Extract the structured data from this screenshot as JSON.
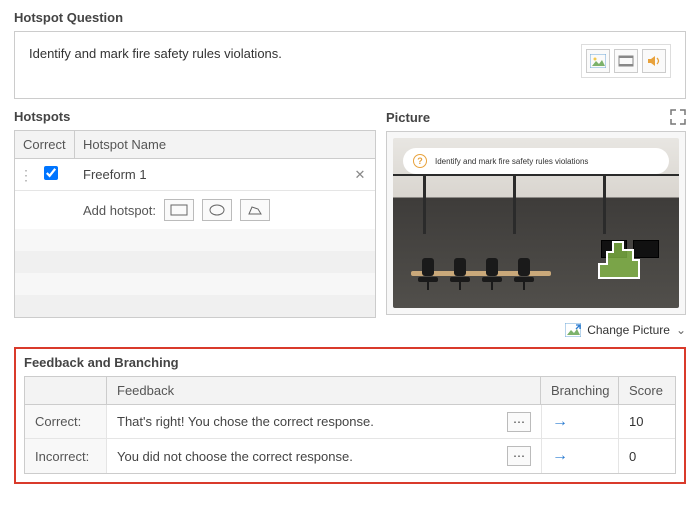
{
  "section_question_title": "Hotspot Question",
  "question_text": "Identify and mark fire safety rules violations.",
  "hotspots": {
    "title": "Hotspots",
    "col_correct": "Correct",
    "col_name": "Hotspot Name",
    "rows": [
      {
        "name": "Freeform 1",
        "correct": true
      }
    ],
    "add_label": "Add hotspot:"
  },
  "picture": {
    "title": "Picture",
    "banner_text": "Identify and mark fire safety rules violations",
    "change_label": "Change Picture"
  },
  "feedback": {
    "title": "Feedback and Branching",
    "col_feedback": "Feedback",
    "col_branching": "Branching",
    "col_score": "Score",
    "rows": [
      {
        "label": "Correct:",
        "text": "That's right! You chose the correct response.",
        "score": "10"
      },
      {
        "label": "Incorrect:",
        "text": "You did not choose the correct response.",
        "score": "0"
      }
    ]
  }
}
